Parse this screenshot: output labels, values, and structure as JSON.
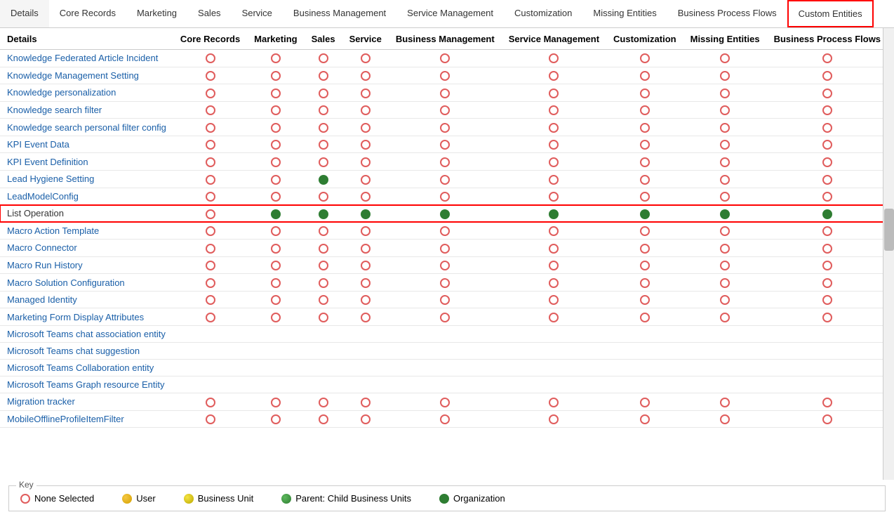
{
  "tabs": [
    {
      "id": "details",
      "label": "Details",
      "active": false
    },
    {
      "id": "core-records",
      "label": "Core Records",
      "active": false
    },
    {
      "id": "marketing",
      "label": "Marketing",
      "active": false
    },
    {
      "id": "sales",
      "label": "Sales",
      "active": false
    },
    {
      "id": "service",
      "label": "Service",
      "active": false
    },
    {
      "id": "business-management",
      "label": "Business Management",
      "active": false
    },
    {
      "id": "service-management",
      "label": "Service Management",
      "active": false
    },
    {
      "id": "customization",
      "label": "Customization",
      "active": false
    },
    {
      "id": "missing-entities",
      "label": "Missing Entities",
      "active": false
    },
    {
      "id": "business-process-flows",
      "label": "Business Process Flows",
      "active": false
    },
    {
      "id": "custom-entities",
      "label": "Custom Entities",
      "active": false,
      "highlighted": true
    }
  ],
  "columns": [
    "Details",
    "Core Records",
    "Marketing",
    "Sales",
    "Service",
    "Business Management",
    "Service Management",
    "Customization",
    "Missing Entities",
    "Business Process Flows",
    "Custom Entities"
  ],
  "rows": [
    {
      "name": "Knowledge Federated Article Incident",
      "type": "link",
      "highlight": false,
      "cells": [
        "none",
        "none",
        "none",
        "none",
        "none",
        "none",
        "none",
        "none",
        "none",
        "none",
        "none"
      ]
    },
    {
      "name": "Knowledge Management Setting",
      "type": "link",
      "highlight": false,
      "cells": [
        "none",
        "none",
        "none",
        "none",
        "none",
        "none",
        "none",
        "none",
        "none",
        "none",
        "none"
      ]
    },
    {
      "name": "Knowledge personalization",
      "type": "link",
      "highlight": false,
      "cells": [
        "none",
        "none",
        "none",
        "none",
        "none",
        "none",
        "none",
        "none",
        "none",
        "none",
        "none"
      ]
    },
    {
      "name": "Knowledge search filter",
      "type": "link",
      "highlight": false,
      "cells": [
        "none",
        "none",
        "none",
        "none",
        "none",
        "none",
        "none",
        "none",
        "none",
        "none",
        "none"
      ]
    },
    {
      "name": "Knowledge search personal filter config",
      "type": "link",
      "highlight": false,
      "cells": [
        "none",
        "none",
        "none",
        "none",
        "none",
        "none",
        "none",
        "none",
        "none",
        "none",
        "none"
      ]
    },
    {
      "name": "KPI Event Data",
      "type": "link",
      "highlight": false,
      "cells": [
        "none",
        "none",
        "none",
        "none",
        "none",
        "none",
        "none",
        "none",
        "none",
        "none",
        "none"
      ]
    },
    {
      "name": "KPI Event Definition",
      "type": "link",
      "highlight": false,
      "cells": [
        "none",
        "none",
        "none",
        "none",
        "none",
        "none",
        "none",
        "none",
        "none",
        "none",
        "none"
      ]
    },
    {
      "name": "Lead Hygiene Setting",
      "type": "link",
      "highlight": false,
      "cells": [
        "none",
        "none",
        "green",
        "none",
        "none",
        "none",
        "none",
        "none",
        "none",
        "none",
        "none"
      ]
    },
    {
      "name": "LeadModelConfig",
      "type": "link",
      "highlight": false,
      "cells": [
        "none",
        "none",
        "none",
        "none",
        "none",
        "none",
        "none",
        "none",
        "none",
        "none",
        "none"
      ]
    },
    {
      "name": "List Operation",
      "type": "plain",
      "highlight": true,
      "cells": [
        "none",
        "green",
        "green",
        "green",
        "green",
        "green",
        "green",
        "green",
        "green",
        "green",
        "green"
      ]
    },
    {
      "name": "Macro Action Template",
      "type": "link",
      "highlight": false,
      "cells": [
        "none",
        "none",
        "none",
        "none",
        "none",
        "none",
        "none",
        "none",
        "none",
        "none",
        "none"
      ]
    },
    {
      "name": "Macro Connector",
      "type": "link",
      "highlight": false,
      "cells": [
        "none",
        "none",
        "none",
        "none",
        "none",
        "none",
        "none",
        "none",
        "none",
        "none",
        "none"
      ]
    },
    {
      "name": "Macro Run History",
      "type": "link",
      "highlight": false,
      "cells": [
        "none",
        "none",
        "none",
        "none",
        "none",
        "none",
        "none",
        "none",
        "none",
        "none",
        "none"
      ]
    },
    {
      "name": "Macro Solution Configuration",
      "type": "link",
      "highlight": false,
      "cells": [
        "none",
        "none",
        "none",
        "none",
        "none",
        "none",
        "none",
        "none",
        "none",
        "none",
        "none"
      ]
    },
    {
      "name": "Managed Identity",
      "type": "link",
      "highlight": false,
      "cells": [
        "none",
        "none",
        "none",
        "none",
        "none",
        "none",
        "none",
        "none",
        "none",
        "none",
        "none"
      ]
    },
    {
      "name": "Marketing Form Display Attributes",
      "type": "link",
      "highlight": false,
      "cells": [
        "none",
        "none",
        "none",
        "none",
        "none",
        "none",
        "none",
        "none",
        "none",
        "none",
        "none"
      ]
    },
    {
      "name": "Microsoft Teams chat association entity",
      "type": "link",
      "highlight": false,
      "cells": [
        "",
        "",
        "",
        "",
        "",
        "",
        "",
        "",
        "",
        "",
        ""
      ]
    },
    {
      "name": "Microsoft Teams chat suggestion",
      "type": "link",
      "highlight": false,
      "cells": [
        "",
        "",
        "",
        "",
        "",
        "",
        "",
        "",
        "",
        "",
        ""
      ]
    },
    {
      "name": "Microsoft Teams Collaboration entity",
      "type": "link",
      "highlight": false,
      "cells": [
        "",
        "",
        "",
        "",
        "",
        "",
        "",
        "",
        "",
        "",
        ""
      ]
    },
    {
      "name": "Microsoft Teams Graph resource Entity",
      "type": "link",
      "highlight": false,
      "cells": [
        "",
        "",
        "",
        "",
        "",
        "",
        "",
        "",
        "",
        "",
        ""
      ]
    },
    {
      "name": "Migration tracker",
      "type": "link",
      "highlight": false,
      "cells": [
        "none",
        "none",
        "none",
        "none",
        "none",
        "none",
        "none",
        "none",
        "none",
        "none",
        "none"
      ]
    },
    {
      "name": "MobileOfflineProfileItemFilter",
      "type": "link",
      "highlight": false,
      "cells": [
        "none",
        "none",
        "none",
        "none",
        "none",
        "none",
        "none",
        "none",
        "none",
        "none",
        "none"
      ]
    }
  ],
  "key": {
    "title": "Key",
    "items": [
      {
        "id": "none-selected",
        "type": "none",
        "label": "None Selected"
      },
      {
        "id": "user",
        "type": "user",
        "label": "User"
      },
      {
        "id": "business-unit",
        "type": "business",
        "label": "Business Unit"
      },
      {
        "id": "parent-child",
        "type": "parent",
        "label": "Parent: Child Business Units"
      },
      {
        "id": "organization",
        "type": "green",
        "label": "Organization"
      }
    ]
  }
}
